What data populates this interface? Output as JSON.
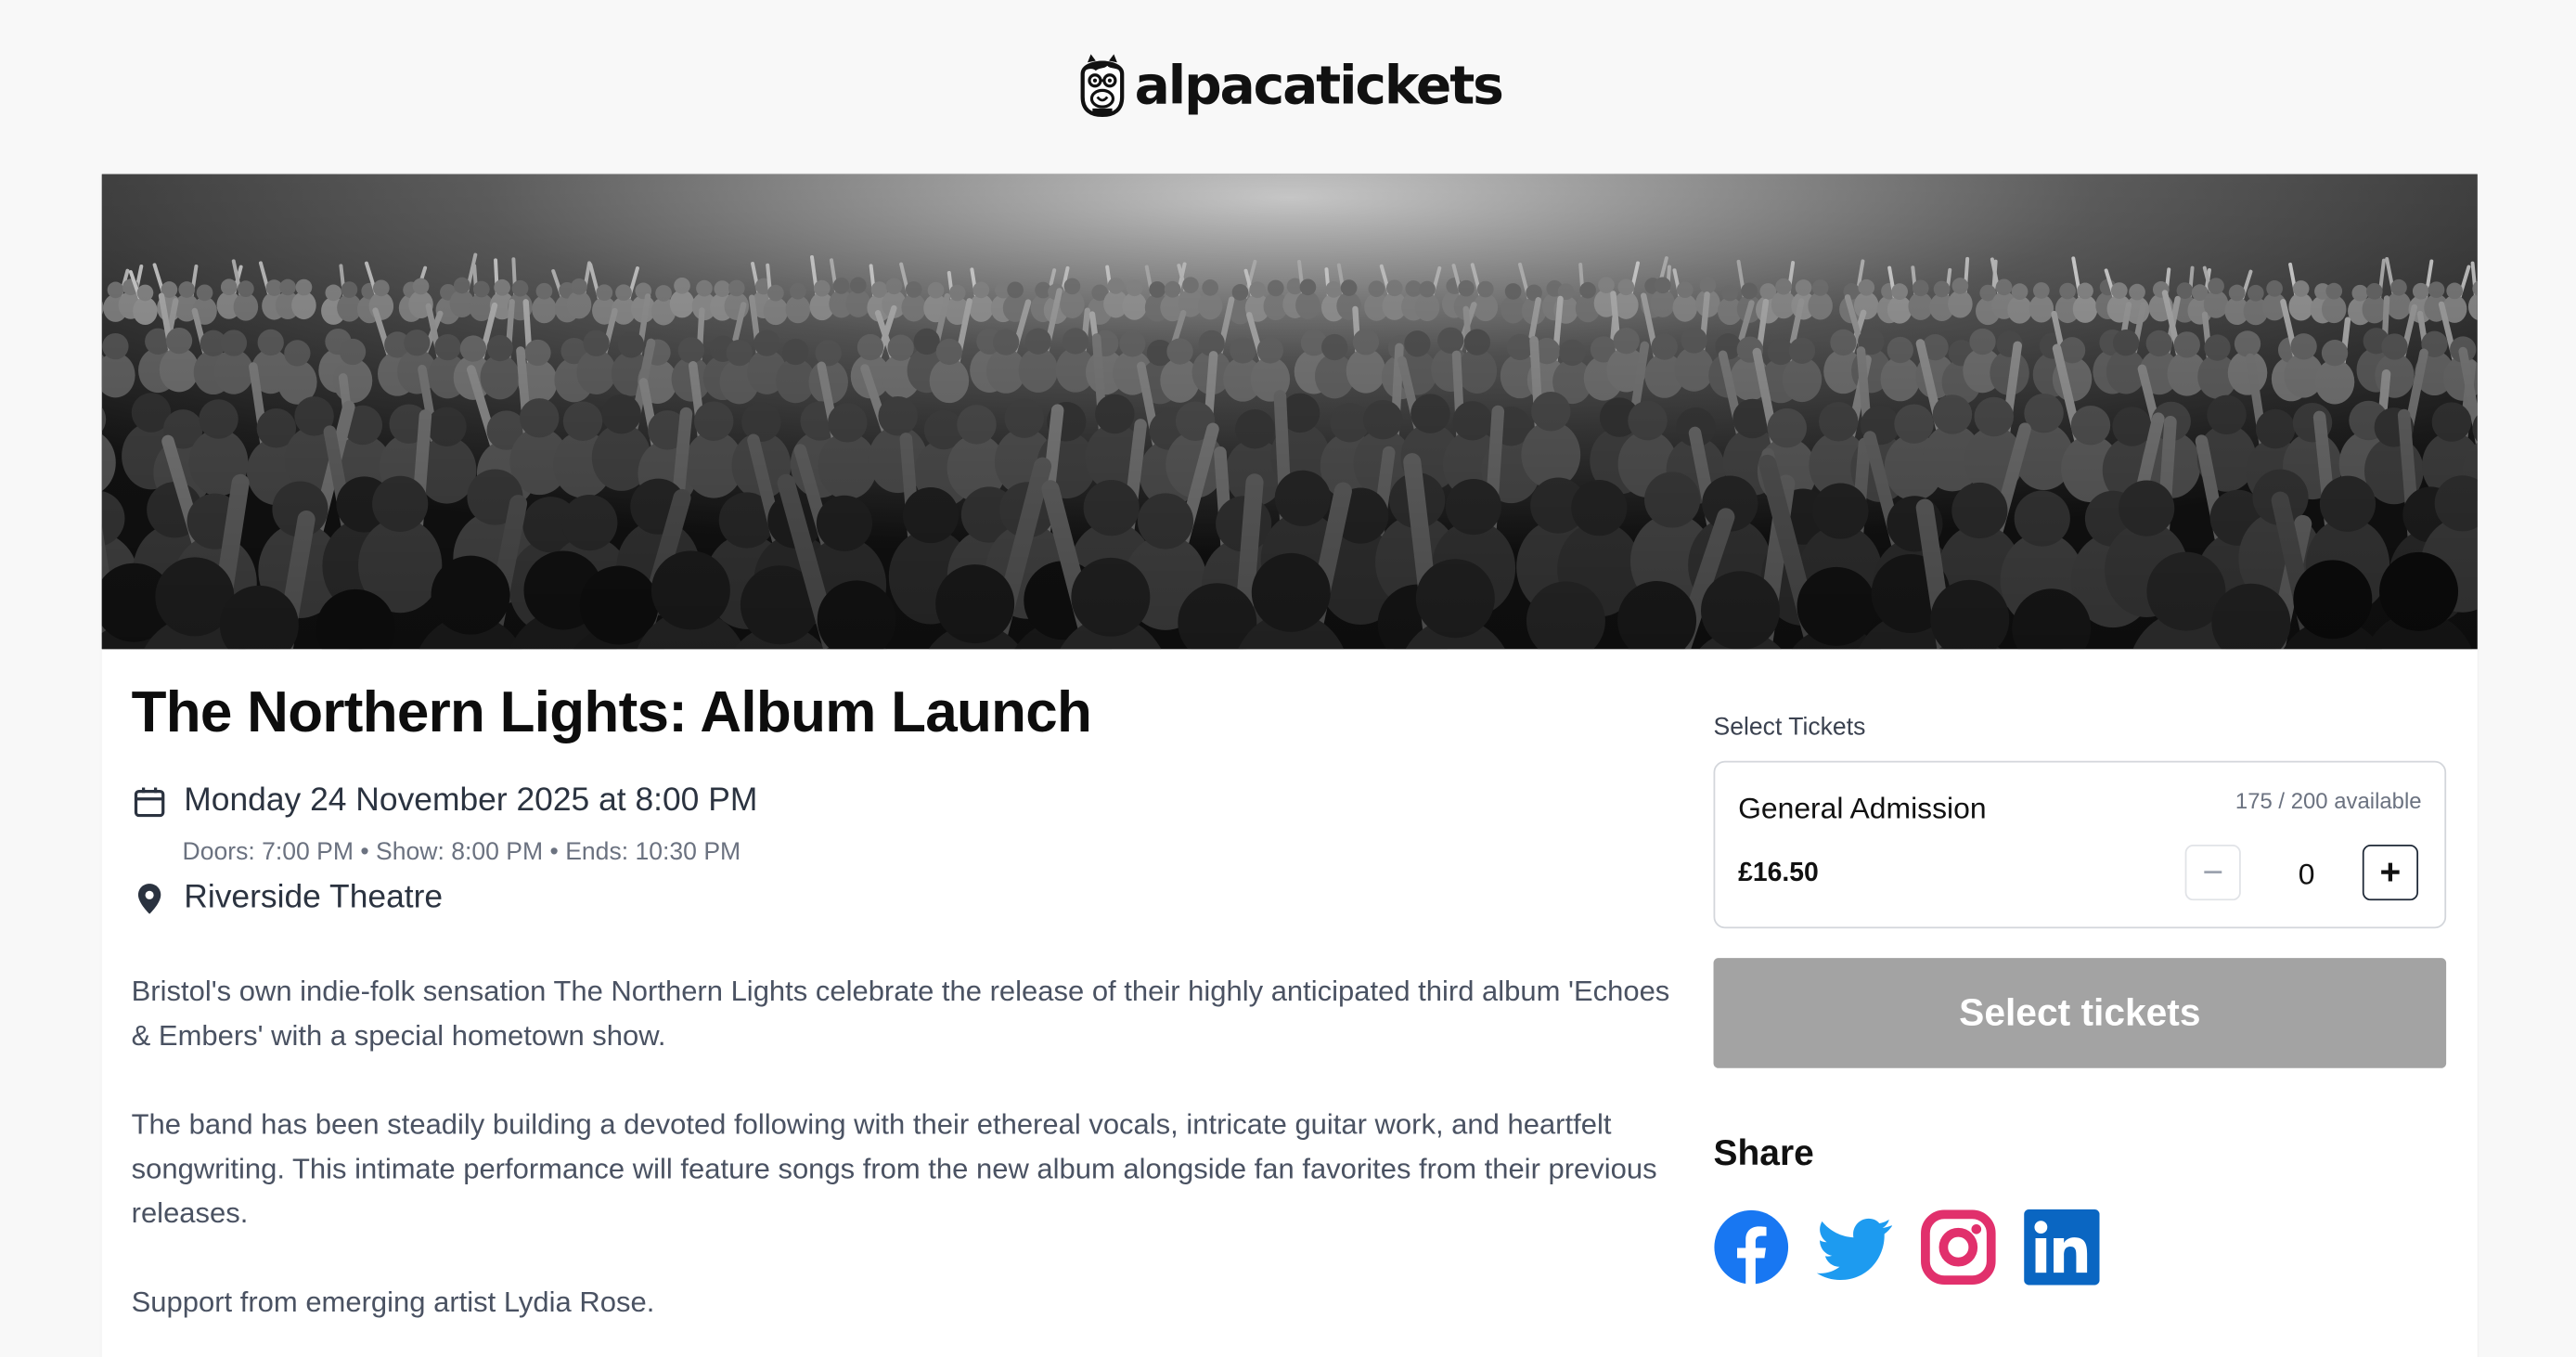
{
  "brand": {
    "logo_text": "alpacatickets",
    "logo_icon": "alpaca-mascot-icon"
  },
  "hero": {
    "image": "black-and-white photo of a concert crowd with raised hands"
  },
  "event": {
    "title": "The Northern Lights: Album Launch",
    "date_text": "Monday 24 November 2025 at 8:00 PM",
    "times_text": "Doors: 7:00 PM • Show: 8:00 PM • Ends: 10:30 PM",
    "venue": "Riverside Theatre",
    "description": [
      "Bristol's own indie-folk sensation The Northern Lights celebrate the release of their highly anticipated third album 'Echoes & Embers' with a special hometown show.",
      "The band has been steadily building a devoted following with their ethereal vocals, intricate guitar work, and heartfelt songwriting. This intimate performance will feature songs from the new album alongside fan favorites from their previous releases.",
      "Support from emerging artist Lydia Rose."
    ]
  },
  "tickets": {
    "label": "Select Tickets",
    "items": [
      {
        "name": "General Admission",
        "availability": "175 / 200 available",
        "price": "£16.50",
        "quantity": "0",
        "decrement_label": "−",
        "increment_label": "+"
      }
    ],
    "button_label": "Select tickets",
    "button_color": "#a3a3a3"
  },
  "share": {
    "heading": "Share",
    "networks": [
      {
        "name": "Facebook",
        "icon": "facebook-icon",
        "color": "#1877f2"
      },
      {
        "name": "Twitter",
        "icon": "twitter-icon",
        "color": "#1d9bf0"
      },
      {
        "name": "Instagram",
        "icon": "instagram-icon",
        "color": "#e1306c"
      },
      {
        "name": "LinkedIn",
        "icon": "linkedin-icon",
        "color": "#0a66c2"
      }
    ]
  },
  "colors": {
    "page_background": "#f8f8f8",
    "card_background": "#ffffff",
    "text_primary": "#0d0d0d",
    "text_muted": "#6b7280"
  }
}
